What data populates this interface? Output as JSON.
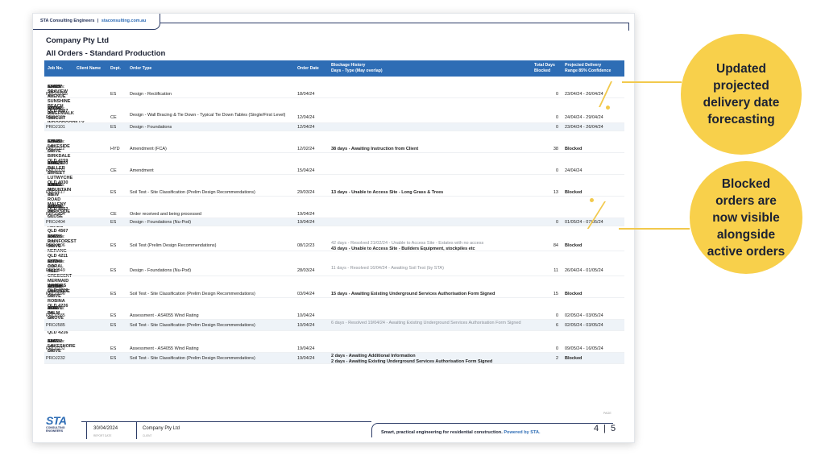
{
  "header": {
    "firm": "STA Consulting Engineers",
    "sep": "|",
    "url": "staconsulting.com.au",
    "company": "Company Pty Ltd",
    "report_title": "All Orders - Standard Production"
  },
  "columns": {
    "job": "Job No.",
    "client": "Client Name",
    "dept": "Dept.",
    "order_type": "Order Type",
    "order_date": "Order Date",
    "blockage_1": "Blockage History",
    "blockage_2": "Days - Type (May overlap)",
    "days_1": "Total Days",
    "days_2": "Blocked",
    "range_1": "Projected Delivery",
    "range_2": "Range 85% Confidence"
  },
  "address_label": "Address:",
  "sta_label": "STA Job No:",
  "groups": [
    {
      "address": "Lot 29 SEAVIEW AVENUE SUNSHINE BEACH QLD 4567",
      "sta_no": "624897",
      "rows": [
        {
          "job": "PROJ5005",
          "dept": "ES",
          "type": "Design - Rectification",
          "date": "18/04/24",
          "block": "",
          "days": "0",
          "range": "23/04/24 - 26/04/24"
        }
      ]
    },
    {
      "address": "Lot 10 RIVERWALK CIRCUIT INDOOROOPILLY QLD 4068",
      "sta_no": "981347",
      "rows": [
        {
          "job": "PROJ101",
          "dept": "CE",
          "type": "Design - Wall Bracing & Tie Down - Typical Tie Down Tables (Single/First Level)",
          "date": "12/04/24",
          "block": "",
          "days": "0",
          "range": "24/04/24 - 29/04/24"
        },
        {
          "job": "PROJ101",
          "dept": "ES",
          "type": "Design - Foundations",
          "date": "12/04/24",
          "block": "",
          "days": "0",
          "range": "23/04/24 - 26/04/24"
        }
      ]
    },
    {
      "address": "Lot 25 LAKESIDE DRIVE BIRKDALE QLD 4159",
      "sta_no": "629483",
      "rows": [
        {
          "job": "PROJ112",
          "dept": "HYD",
          "type": "Amendment (FCA)",
          "date": "12/02/24",
          "block": "38 days - Awaiting Instruction from Client",
          "days": "38",
          "range": "Blocked"
        }
      ]
    },
    {
      "address": "Lot 5, 120 FULLER STREET LUTWYCHE QLD 4030",
      "sta_no": "574629",
      "rows": [
        {
          "job": "PROJ131",
          "dept": "CE",
          "type": "Amendment",
          "date": "15/04/24",
          "block": "",
          "days": "0",
          "range": "24/04/24"
        }
      ]
    },
    {
      "address": "Lot 19 MOUNTAIN VIEW ROAD MALENY QLD 4552",
      "sta_no": "836451",
      "rows": [
        {
          "job": "PROJ617",
          "dept": "ES",
          "type": "Soil Test - Site Classification (Prelim Design Recommendations)",
          "date": "29/03/24",
          "block": "13 days - Unable to Access Site - Long Grass & Trees",
          "days": "13",
          "range": "Blocked"
        }
      ]
    },
    {
      "address": "Lot 14 PARKSIDE CLOSE NOOSA HEADS QLD 4567",
      "sta_no": "492716",
      "rows": [
        {
          "job": "PROJ404",
          "dept": "CE",
          "type": "Order received and being processed",
          "date": "19/04/24",
          "block": "",
          "days": "",
          "range": ""
        },
        {
          "job": "PROJ404",
          "dept": "ES",
          "type": "Design - Foundations (Nu-Pod)",
          "date": "19/04/24",
          "block": "",
          "days": "0",
          "range": "01/05/24 - 07/05/24"
        }
      ]
    },
    {
      "address": "Lot 5 RAINFOREST DRIVE NERANG QLD 4211",
      "sta_no": "304785",
      "rows": [
        {
          "job": "PROJ606",
          "dept": "ES",
          "type": "Soil Test (Prelim Design Recommendations)",
          "date": "08/12/23",
          "block_muted": "42 days - Resolved 21/02/24 - Unable to Access Site - Estates with no access",
          "block": "43 days - Unable to Access Site - Builders Equipment, stockpiles etc",
          "days": "84",
          "range": "Blocked"
        }
      ]
    },
    {
      "address": "Lot 9 CORAL REEF CRESCENT MERMAID WATERS QLD 4218",
      "sta_no": "657249",
      "rows": [
        {
          "job": "PROJ949",
          "dept": "ES",
          "type": "Design - Foundations (Nu-Pod)",
          "date": "28/03/24",
          "block_muted": "11 days - Resolved 16/04/24 - Awaiting Soil Test (by STA)",
          "block": "",
          "days": "11",
          "range": "26/04/24 - 01/05/24"
        }
      ]
    },
    {
      "address": "Lot 13 LAKESIDE DRIVE ROBINA QLD 4226",
      "sta_no": "821946",
      "rows": [
        {
          "job": "PROJ696",
          "dept": "ES",
          "type": "Soil Test - Site Classification (Prelim Design Recommendations)",
          "date": "03/04/24",
          "block": "15 days - Awaiting Existing Underground Services Authorisation Form Signed",
          "days": "15",
          "range": "Blocked"
        }
      ]
    },
    {
      "address": "Lot 2 PALM GROVE PARADISE POINT QLD 4216",
      "sta_no": "493871",
      "rows": [
        {
          "job": "PROJ585",
          "dept": "ES",
          "type": "Assessment - AS4055 Wind Rating",
          "date": "10/04/24",
          "block": "",
          "days": "0",
          "range": "02/05/24 - 03/05/24"
        },
        {
          "job": "PROJ585",
          "dept": "ES",
          "type": "Soil Test - Site Classification (Prelim Design Recommendations)",
          "date": "10/04/24",
          "block_muted": "6 days - Resolved 19/04/24 - Awaiting Existing Underground Services Authorisation Form Signed",
          "block": "",
          "days": "6",
          "range": "02/05/24 - 03/05/24"
        }
      ]
    },
    {
      "address": "Lot 6 LAKESHORE DRIVE MOOLOOLABA QLD 4557",
      "sta_no": "814732",
      "rows": [
        {
          "job": "PROJ232",
          "dept": "ES",
          "type": "Assessment - AS4055 Wind Rating",
          "date": "19/04/24",
          "block": "",
          "days": "0",
          "range": "09/05/24 - 16/05/24"
        },
        {
          "job": "PROJ232",
          "dept": "ES",
          "type": "Soil Test - Site Classification (Prelim Design Recommendations)",
          "date": "19/04/24",
          "block": "2 days - Awaiting Additional Information",
          "block2": "2 days - Awaiting Existing Underground Services Authorisation Form Signed",
          "days": "2",
          "range": "Blocked"
        }
      ]
    }
  ],
  "footer": {
    "logo": "STA",
    "logo_sub": "CONSULTING ENGINEERS",
    "date": "30/04/2024",
    "date_sub": "REPORT DATE",
    "company": "Company Pty Ltd",
    "company_sub": "CLIENT",
    "tagline": "Smart, practical engineering for residential construction.",
    "powered": "Powered by STA.",
    "page_label": "PAGE",
    "page": "4",
    "page_sep": "|",
    "pages": "5"
  },
  "callouts": {
    "one": [
      "Updated",
      "projected",
      "delivery date",
      "forecasting"
    ],
    "two": [
      "Blocked",
      "orders are",
      "now visible",
      "alongside",
      "active orders"
    ]
  },
  "colors": {
    "accent": "#2e6db5",
    "callout": "#f8d04b",
    "navy": "#2b3b66"
  }
}
